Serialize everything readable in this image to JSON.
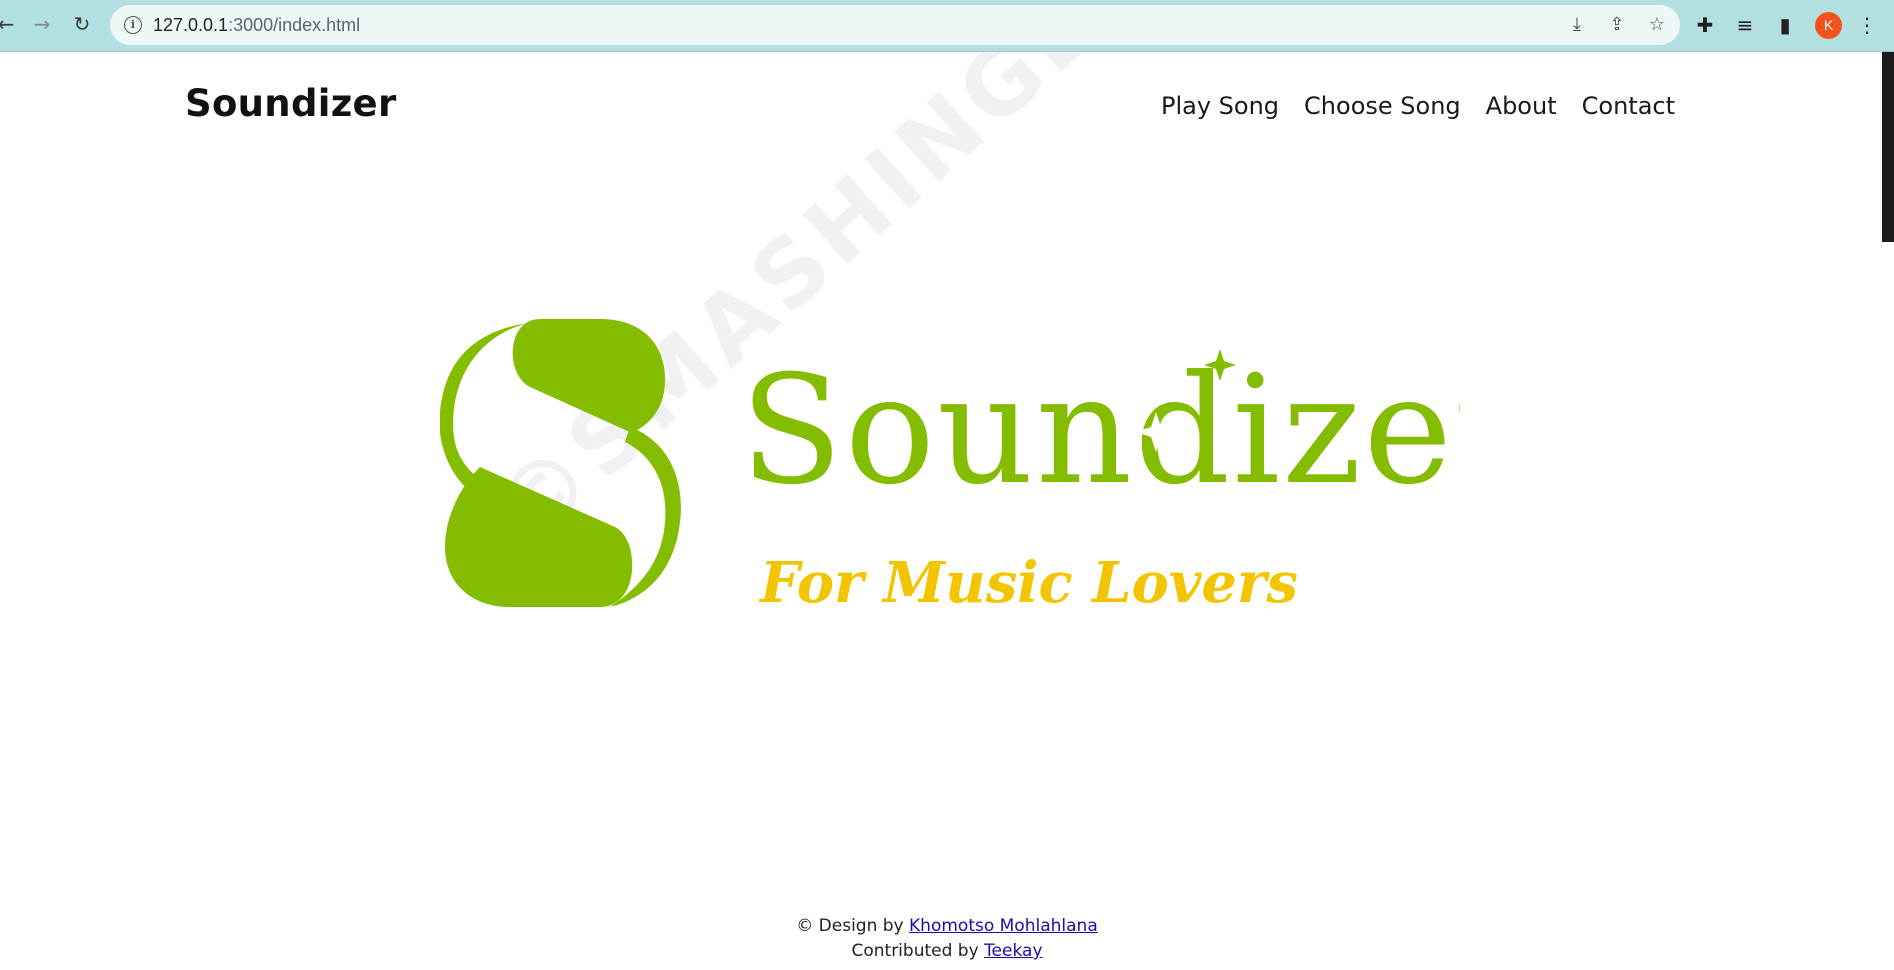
{
  "browser": {
    "url_host": "127.0.0.1",
    "url_path": ":3000/index.html",
    "avatar_initial": "K",
    "accent_color": "#b2e0e0"
  },
  "site": {
    "brand": "Soundizer",
    "nav": [
      "Play Song",
      "Choose Song",
      "About",
      "Contact"
    ]
  },
  "hero": {
    "logo_wordmark": "Soundizer",
    "logo_tagline": "For Music Lovers",
    "logo_color": "#84bd00",
    "tagline_color": "#f2c500",
    "watermark": "©SMASHINGLOGO"
  },
  "footer": {
    "design_prefix": "© Design by",
    "designer": "Khomotso Mohlahlana",
    "contrib_prefix": "Contributed by",
    "contributor": "Teekay"
  }
}
